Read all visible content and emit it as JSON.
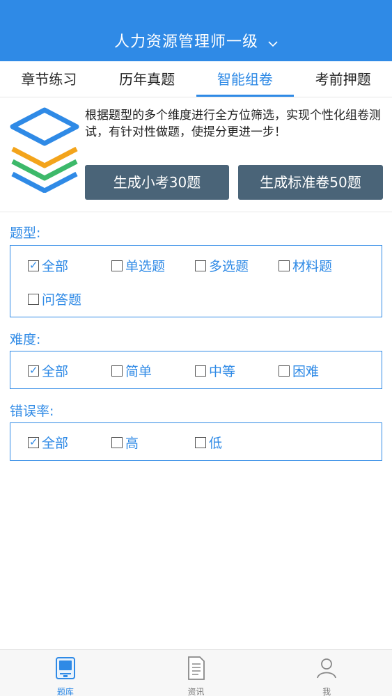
{
  "header": {
    "title": "人力资源管理师一级"
  },
  "tabs": [
    {
      "label": "章节练习"
    },
    {
      "label": "历年真题"
    },
    {
      "label": "智能组卷"
    },
    {
      "label": "考前押题"
    }
  ],
  "intro": {
    "description": "根据题型的多个维度进行全方位筛选，实现个性化组卷测试，有针对性做题，使提分更进一步！",
    "quiz_button": "生成小考30题",
    "standard_button": "生成标准卷50题"
  },
  "filters": {
    "question_type": {
      "label": "题型:",
      "options": [
        {
          "label": "全部",
          "checked": true
        },
        {
          "label": "单选题",
          "checked": false
        },
        {
          "label": "多选题",
          "checked": false
        },
        {
          "label": "材料题",
          "checked": false
        },
        {
          "label": "问答题",
          "checked": false
        }
      ]
    },
    "difficulty": {
      "label": "难度:",
      "options": [
        {
          "label": "全部",
          "checked": true
        },
        {
          "label": "简单",
          "checked": false
        },
        {
          "label": "中等",
          "checked": false
        },
        {
          "label": "困难",
          "checked": false
        }
      ]
    },
    "error_rate": {
      "label": "错误率:",
      "options": [
        {
          "label": "全部",
          "checked": true
        },
        {
          "label": "高",
          "checked": false
        },
        {
          "label": "低",
          "checked": false
        }
      ]
    }
  },
  "bottom_nav": [
    {
      "label": "题库",
      "icon": "question-bank-icon"
    },
    {
      "label": "资讯",
      "icon": "news-document-icon"
    },
    {
      "label": "我",
      "icon": "profile-icon"
    }
  ],
  "colors": {
    "accent": "#2f8ae6",
    "button": "#4a6478"
  }
}
